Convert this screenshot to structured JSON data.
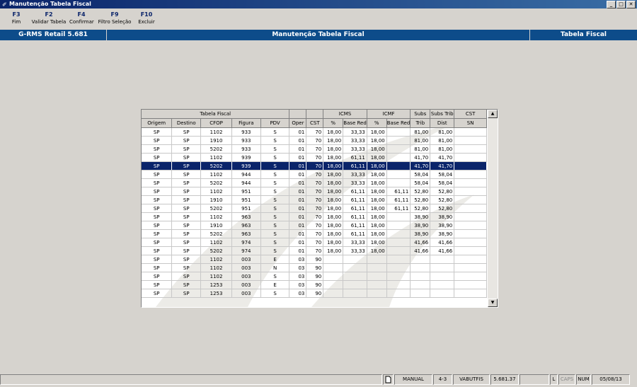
{
  "window": {
    "title": "Manutenção Tabela Fiscal"
  },
  "fkeys": [
    {
      "key": "F3",
      "label": "Fim"
    },
    {
      "key": "F2",
      "label": "Validar Tabela"
    },
    {
      "key": "F4",
      "label": "Confirmar"
    },
    {
      "key": "F9",
      "label": "Filtro Seleção"
    },
    {
      "key": "F10",
      "label": "Excluir"
    }
  ],
  "header": {
    "app": "G-RMS Retail 5.681",
    "screen": "Manutenção Tabela Fiscal",
    "section": "Tabela Fiscal"
  },
  "grid": {
    "group_headers": {
      "tabela_fiscal": "Tabela Fiscal",
      "icms": "ICMS",
      "icmf": "ICMF",
      "subs": "Subs",
      "subs_trib": "Subs Trib",
      "cst": "CST"
    },
    "columns": [
      "Origem",
      "Destino",
      "CFOP",
      "Figura",
      "PDV",
      "Oper",
      "CST",
      "%",
      "Base Red",
      "%",
      "Base Red",
      "Trib",
      "Dist",
      "SN"
    ],
    "rows": [
      [
        "SP",
        "SP",
        "1102",
        "933",
        "S",
        "01",
        "70",
        "18,00",
        "33,33",
        "18,00",
        "",
        "81,00",
        "81,00",
        ""
      ],
      [
        "SP",
        "SP",
        "1910",
        "933",
        "S",
        "01",
        "70",
        "18,00",
        "33,33",
        "18,00",
        "",
        "81,00",
        "81,00",
        ""
      ],
      [
        "SP",
        "SP",
        "5202",
        "933",
        "S",
        "01",
        "70",
        "18,00",
        "33,33",
        "18,00",
        "",
        "81,00",
        "81,00",
        ""
      ],
      [
        "SP",
        "SP",
        "1102",
        "939",
        "S",
        "01",
        "70",
        "18,00",
        "61,11",
        "18,00",
        "",
        "41,70",
        "41,70",
        ""
      ],
      [
        "SP",
        "SP",
        "5202",
        "939",
        "S",
        "01",
        "70",
        "18,00",
        "61,11",
        "18,00",
        "",
        "41,70",
        "41,70",
        ""
      ],
      [
        "SP",
        "SP",
        "1102",
        "944",
        "S",
        "01",
        "70",
        "18,00",
        "33,33",
        "18,00",
        "",
        "58,04",
        "58,04",
        ""
      ],
      [
        "SP",
        "SP",
        "5202",
        "944",
        "S",
        "01",
        "70",
        "18,00",
        "33,33",
        "18,00",
        "",
        "58,04",
        "58,04",
        ""
      ],
      [
        "SP",
        "SP",
        "1102",
        "951",
        "S",
        "01",
        "70",
        "18,00",
        "61,11",
        "18,00",
        "61,11",
        "52,80",
        "52,80",
        ""
      ],
      [
        "SP",
        "SP",
        "1910",
        "951",
        "S",
        "01",
        "70",
        "18,00",
        "61,11",
        "18,00",
        "61,11",
        "52,80",
        "52,80",
        ""
      ],
      [
        "SP",
        "SP",
        "5202",
        "951",
        "S",
        "01",
        "70",
        "18,00",
        "61,11",
        "18,00",
        "61,11",
        "52,80",
        "52,80",
        ""
      ],
      [
        "SP",
        "SP",
        "1102",
        "963",
        "S",
        "01",
        "70",
        "18,00",
        "61,11",
        "18,00",
        "",
        "38,90",
        "38,90",
        ""
      ],
      [
        "SP",
        "SP",
        "1910",
        "963",
        "S",
        "01",
        "70",
        "18,00",
        "61,11",
        "18,00",
        "",
        "38,90",
        "38,90",
        ""
      ],
      [
        "SP",
        "SP",
        "5202",
        "963",
        "S",
        "01",
        "70",
        "18,00",
        "61,11",
        "18,00",
        "",
        "38,90",
        "38,90",
        ""
      ],
      [
        "SP",
        "SP",
        "1102",
        "974",
        "S",
        "01",
        "70",
        "18,00",
        "33,33",
        "18,00",
        "",
        "41,66",
        "41,66",
        ""
      ],
      [
        "SP",
        "SP",
        "5202",
        "974",
        "S",
        "01",
        "70",
        "18,00",
        "33,33",
        "18,00",
        "",
        "41,66",
        "41,66",
        ""
      ],
      [
        "SP",
        "SP",
        "1102",
        "003",
        "E",
        "03",
        "90",
        "",
        "",
        "",
        "",
        "",
        "",
        ""
      ],
      [
        "SP",
        "SP",
        "1102",
        "003",
        "N",
        "03",
        "90",
        "",
        "",
        "",
        "",
        "",
        "",
        ""
      ],
      [
        "SP",
        "SP",
        "1102",
        "003",
        "S",
        "03",
        "90",
        "",
        "",
        "",
        "",
        "",
        "",
        ""
      ],
      [
        "SP",
        "SP",
        "1253",
        "003",
        "E",
        "03",
        "90",
        "",
        "",
        "",
        "",
        "",
        "",
        ""
      ],
      [
        "SP",
        "SP",
        "1253",
        "003",
        "S",
        "03",
        "90",
        "",
        "",
        "",
        "",
        "",
        "",
        ""
      ]
    ],
    "selected_row": 4
  },
  "status": {
    "mode": "MANUAL",
    "screen_code": "4-3",
    "user": "VABUTFIS",
    "version": "5.681.37",
    "l": "L",
    "caps": "CAPS",
    "num": "NUM",
    "date": "05/08/13"
  },
  "colors": {
    "titlebar": "#0a246a",
    "band": "#0d4c8a",
    "selection": "#0a246a",
    "face": "#d6d3ce"
  }
}
